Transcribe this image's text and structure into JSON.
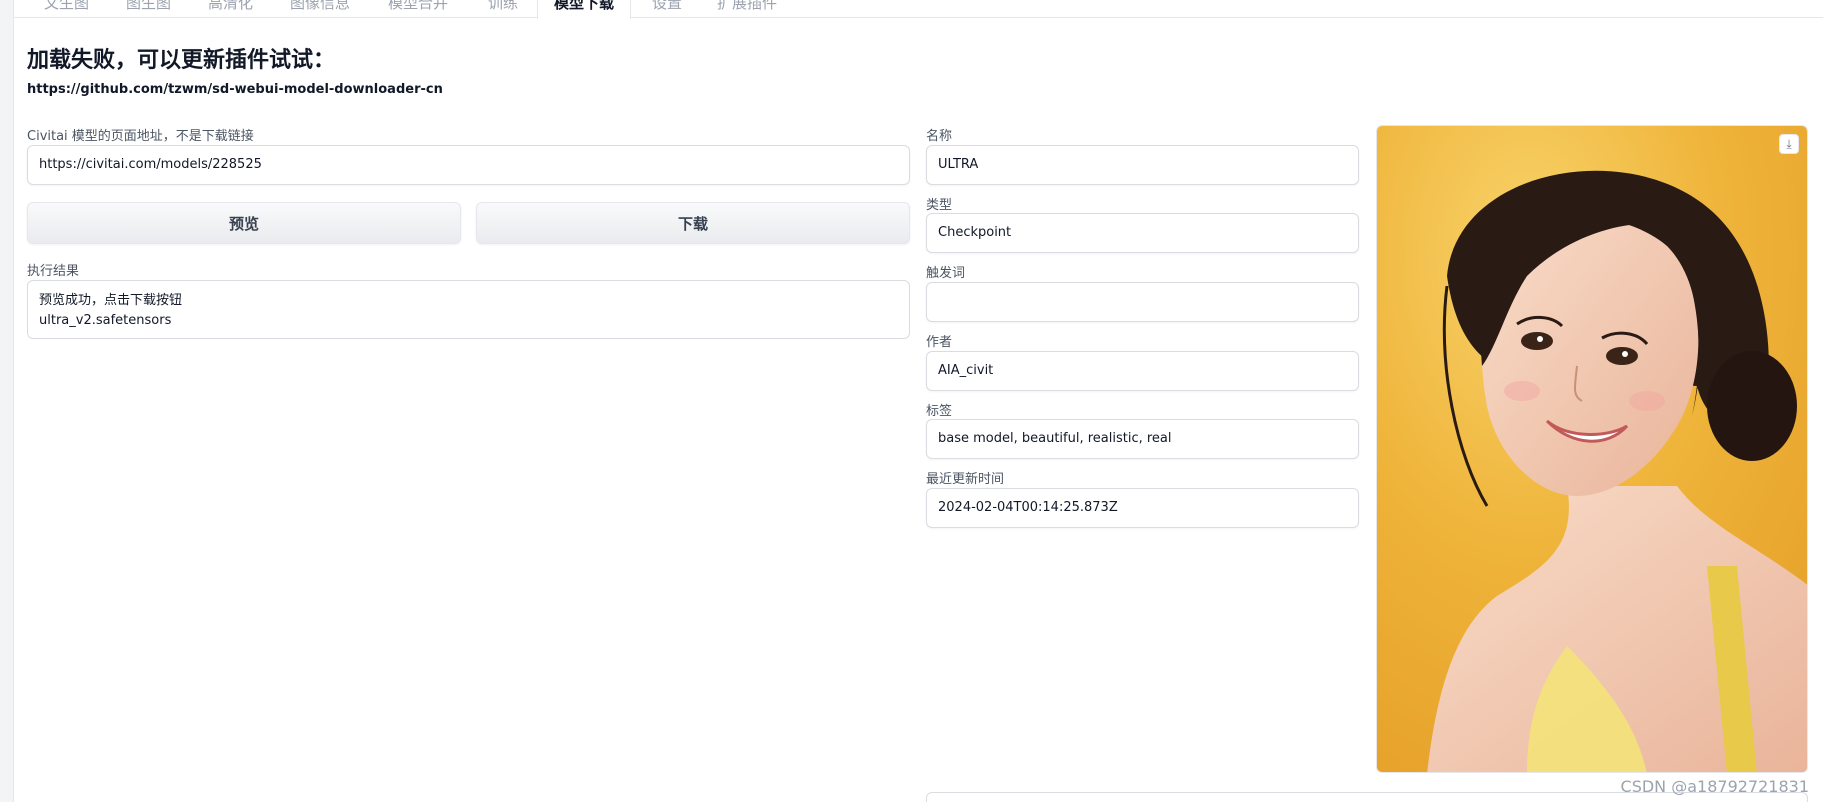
{
  "tabs": [
    {
      "label": "文生图"
    },
    {
      "label": "图生图"
    },
    {
      "label": "高清化"
    },
    {
      "label": "图像信息"
    },
    {
      "label": "模型合并"
    },
    {
      "label": "训练"
    },
    {
      "label": "模型下载",
      "active": true
    },
    {
      "label": "设置"
    },
    {
      "label": "扩展插件"
    }
  ],
  "header": {
    "title": "加载失败，可以更新插件试试：",
    "link": "https://github.com/tzwm/sd-webui-model-downloader-cn"
  },
  "form": {
    "url_label": "Civitai 模型的页面地址，不是下载链接",
    "url_value": "https://civitai.com/models/228525",
    "preview_button": "预览",
    "download_button": "下载",
    "result_label": "执行结果",
    "result_line1": "预览成功，点击下载按钮",
    "result_line2": "ultra_v2.safetensors"
  },
  "info": {
    "name_label": "名称",
    "name_value": "ULTRA",
    "type_label": "类型",
    "type_value": "Checkpoint",
    "trigger_label": "触发词",
    "trigger_value": "",
    "author_label": "作者",
    "author_value": "AIA_civit",
    "tags_label": "标签",
    "tags_value": "base model, beautiful, realistic, real",
    "updated_label": "最近更新时间",
    "updated_value": "2024-02-04T00:14:25.873Z"
  },
  "image": {
    "download_icon": "download-icon",
    "bg_color": "#efb43a"
  },
  "watermark": "CSDN @a18792721831"
}
